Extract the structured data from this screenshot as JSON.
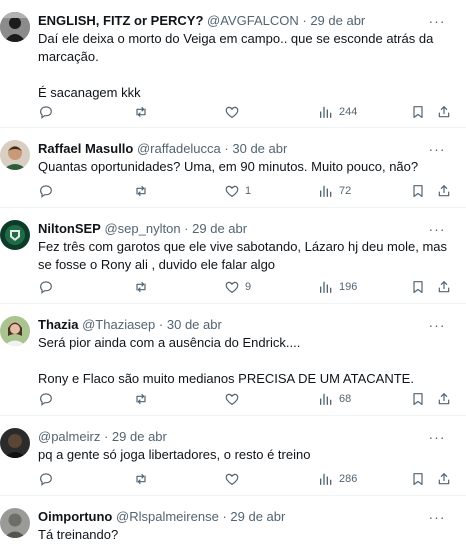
{
  "tweets": [
    {
      "avatar": "avatar-dark-figure",
      "name": "ENGLISH, FITZ or PERCY?",
      "handle": "@AVGFALCON",
      "date": "29 de abr",
      "lines": [
        "Daí ele deixa o morto do Veiga em campo.. que se esconde atrás da marcação.",
        "É sacanagem kkk"
      ],
      "replies": "",
      "retweets": "",
      "likes": "",
      "views": "244"
    },
    {
      "avatar": "avatar-person",
      "name": "Raffael Masullo",
      "handle": "@raffadelucca",
      "date": "30 de abr",
      "lines": [
        "Quantas oportunidades? Uma, em 90 minutos. Muito pouco, não?"
      ],
      "replies": "",
      "retweets": "",
      "likes": "1",
      "views": "72"
    },
    {
      "avatar": "avatar-green-crest",
      "name": "NiltonSEP",
      "handle": "@sep_nylton",
      "date": "29 de abr",
      "lines": [
        "Fez três com garotos que ele vive sabotando, Lázaro hj deu mole, mas se fosse o Rony ali , duvido ele falar algo"
      ],
      "replies": "",
      "retweets": "",
      "likes": "9",
      "views": "196"
    },
    {
      "avatar": "avatar-person-outdoor",
      "name": "Thazia",
      "handle": "@Thaziasep",
      "date": "30 de abr",
      "lines": [
        "Será pior ainda com a ausência do Endrick....",
        "Rony e Flaco são muito medianos PRECISA DE UM ATACANTE."
      ],
      "replies": "",
      "retweets": "",
      "likes": "",
      "views": "68"
    },
    {
      "avatar": "avatar-dark-photo",
      "name": "",
      "handle": "@palmeirz",
      "date": "29 de abr",
      "lines": [
        "pq a gente só joga libertadores, o resto é treino"
      ],
      "replies": "",
      "retweets": "",
      "likes": "",
      "views": "286"
    },
    {
      "avatar": "avatar-gray-photo",
      "name": "Oimportuno",
      "handle": "@Rlspalmeirense",
      "date": "29 de abr",
      "lines": [
        "Tá treinando?"
      ],
      "replies": "",
      "retweets": "",
      "likes": "",
      "views": ""
    }
  ],
  "dot": "·",
  "more_glyph": "···",
  "colors": {
    "text": "#0f1419",
    "muted": "#536471",
    "divider": "#eff3f4"
  }
}
